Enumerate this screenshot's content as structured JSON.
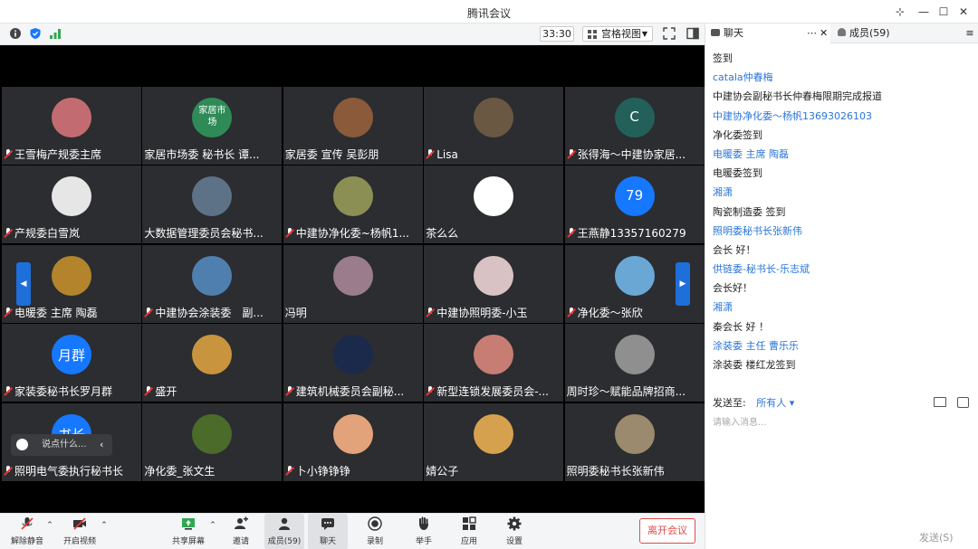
{
  "window": {
    "title": "腾讯会议"
  },
  "toolbar": {
    "timer": "33:30",
    "view_label": "宫格视图"
  },
  "tiles": [
    {
      "name": "王雪梅产规委主席",
      "muted": true,
      "avatar_text": "",
      "avatar_color": "#c26c72"
    },
    {
      "name": "家居市场委 秘书长 谭...",
      "muted": false,
      "avatar_text": "家居市场",
      "avatar_color": "#2e8b57"
    },
    {
      "name": "家居委 宣传 吴彭朋",
      "muted": false,
      "avatar_text": "",
      "avatar_color": "#8a5a3a"
    },
    {
      "name": "Lisa",
      "muted": true,
      "avatar_text": "",
      "avatar_color": "#6b5842"
    },
    {
      "name": "张得海～中建协家居...",
      "muted": true,
      "avatar_text": "C",
      "avatar_color": "#23605a"
    },
    {
      "name": "产规委白雪岚",
      "muted": true,
      "avatar_text": "",
      "avatar_color": "#e6e6e6"
    },
    {
      "name": "大数据管理委员会秘书...",
      "muted": false,
      "avatar_text": "",
      "avatar_color": "#5d7187"
    },
    {
      "name": "中建协净化委~杨帆1...",
      "muted": true,
      "avatar_text": "",
      "avatar_color": "#8c8f54"
    },
    {
      "name": "茶么么",
      "muted": false,
      "avatar_text": "",
      "avatar_color": "#ffffff"
    },
    {
      "name": "王燕静13357160279",
      "muted": true,
      "avatar_text": "79",
      "avatar_color": "#1677ff"
    },
    {
      "name": "电暖委 主席 陶磊",
      "muted": true,
      "avatar_text": "",
      "avatar_color": "#b3842c"
    },
    {
      "name": "中建协会涂装委　副...",
      "muted": true,
      "avatar_text": "",
      "avatar_color": "#4f7fae"
    },
    {
      "name": "冯明",
      "muted": false,
      "avatar_text": "",
      "avatar_color": "#9a7c8d"
    },
    {
      "name": "中建协照明委-小玉",
      "muted": true,
      "avatar_text": "",
      "avatar_color": "#d9c2c4"
    },
    {
      "name": "净化委～张欣",
      "muted": true,
      "avatar_text": "",
      "avatar_color": "#6aa7d4"
    },
    {
      "name": "家装委秘书长罗月群",
      "muted": true,
      "avatar_text": "月群",
      "avatar_color": "#1677ff"
    },
    {
      "name": "盛开",
      "muted": true,
      "avatar_text": "",
      "avatar_color": "#c8953e"
    },
    {
      "name": "建筑机械委员会副秘...",
      "muted": true,
      "avatar_text": "",
      "avatar_color": "#1b2a4a"
    },
    {
      "name": "新型连锁发展委员会-...",
      "muted": true,
      "avatar_text": "",
      "avatar_color": "#c77d74"
    },
    {
      "name": "周时珍～赋能品牌招商...",
      "muted": false,
      "avatar_text": "",
      "avatar_color": "#8f8f8f"
    },
    {
      "name": "照明电气委执行秘书长",
      "muted": true,
      "avatar_text": "书长",
      "avatar_color": "#1677ff"
    },
    {
      "name": "净化委_张文生",
      "muted": false,
      "avatar_text": "",
      "avatar_color": "#4a6b2a"
    },
    {
      "name": "卜小铮铮铮",
      "muted": true,
      "avatar_text": "",
      "avatar_color": "#e2a27a"
    },
    {
      "name": "婧公子",
      "muted": false,
      "avatar_text": "",
      "avatar_color": "#d6a14f"
    },
    {
      "name": "照明委秘书长张新伟",
      "muted": false,
      "avatar_text": "",
      "avatar_color": "#9c8a6e"
    }
  ],
  "chat_popup": {
    "placeholder": "说点什么..."
  },
  "bottom_bar": {
    "unmute": "解除静音",
    "video": "开启视频",
    "share": "共享屏幕",
    "invite": "邀请",
    "members": "成员(59)",
    "chat": "聊天",
    "record": "录制",
    "raise_hand": "举手",
    "apps": "应用",
    "settings": "设置",
    "leave": "离开会议"
  },
  "panel": {
    "chat_tab": "聊天",
    "members_tab": "成员(59)",
    "messages": [
      {
        "text": "签到",
        "style": "black"
      },
      {
        "text": "catala仲春梅",
        "style": "blue"
      },
      {
        "text": "中建协会副秘书长仲春梅限期完成报道",
        "style": "black"
      },
      {
        "text": "中建协净化委～杨帆13693026103",
        "style": "blue"
      },
      {
        "text": "净化委签到",
        "style": "black"
      },
      {
        "text": "电暖委 主席 陶磊",
        "style": "blue"
      },
      {
        "text": "电暖委签到",
        "style": "black"
      },
      {
        "text": "湘潇",
        "style": "blue"
      },
      {
        "text": "陶瓷制造委 签到",
        "style": "black"
      },
      {
        "text": "照明委秘书长张新伟",
        "style": "blue"
      },
      {
        "text": "会长 好！",
        "style": "black"
      },
      {
        "text": "供链委-秘书长-乐志斌",
        "style": "blue"
      },
      {
        "text": "会长好！",
        "style": "black"
      },
      {
        "text": "湘潇",
        "style": "blue"
      },
      {
        "text": "秦会长 好 ！",
        "style": "black"
      },
      {
        "text": "涂装委 主任 曹乐乐",
        "style": "blue"
      },
      {
        "text": "涂装委 楼红龙签到",
        "style": "black"
      }
    ],
    "send_to_label": "发送至:",
    "send_to_target": "所有人",
    "input_placeholder": "请输入消息...",
    "send_button": "发送(S)"
  }
}
